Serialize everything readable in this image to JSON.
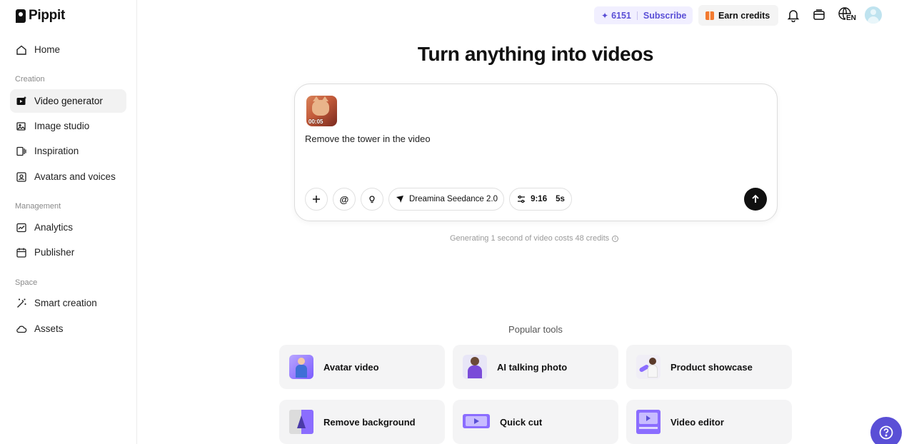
{
  "app": {
    "name": "Pippit"
  },
  "sidebar": {
    "home": "Home",
    "sections": {
      "creation": "Creation",
      "management": "Management",
      "space": "Space"
    },
    "creation_items": [
      "Video generator",
      "Image studio",
      "Inspiration",
      "Avatars and voices"
    ],
    "management_items": [
      "Analytics",
      "Publisher"
    ],
    "space_items": [
      "Smart creation",
      "Assets"
    ],
    "active": "Video generator"
  },
  "topbar": {
    "credits": "6151",
    "subscribe": "Subscribe",
    "earn_credits": "Earn credits",
    "language": "EN"
  },
  "main": {
    "headline": "Turn anything into videos",
    "composer": {
      "thumb_duration": "00:05",
      "prompt": "Remove the tower in the video",
      "model": "Dreamina Seedance 2.0",
      "ratio": "9:16",
      "duration": "5s"
    },
    "cost_note": "Generating 1 second of video costs 48 credits",
    "popular_label": "Popular tools",
    "tools": [
      "Avatar video",
      "AI talking photo",
      "Product showcase",
      "Remove background",
      "Quick cut",
      "Video editor"
    ]
  },
  "colors": {
    "accent": "#5a4fd6",
    "credit_bg": "#f1efff",
    "card_bg": "#f4f4f5"
  }
}
